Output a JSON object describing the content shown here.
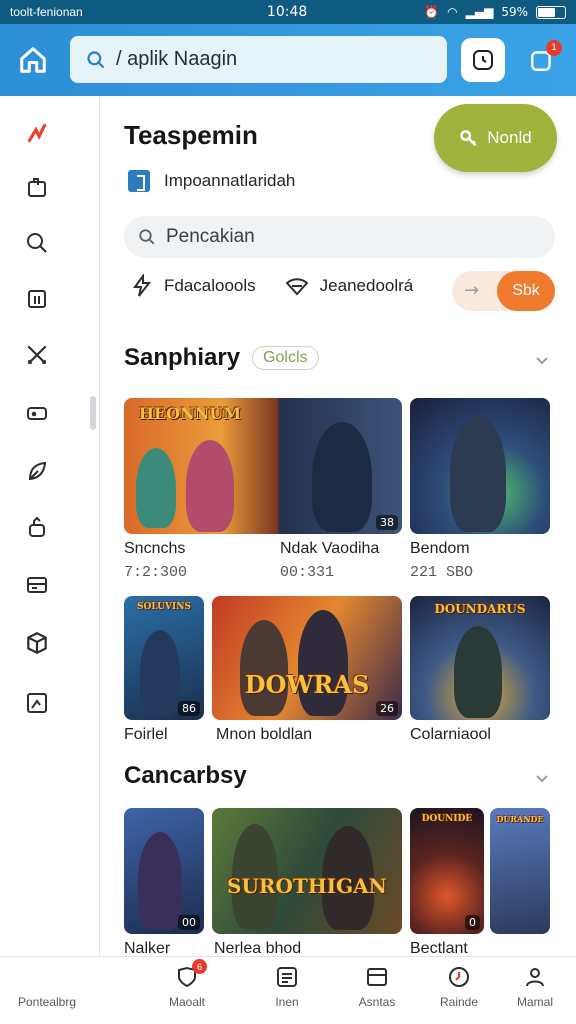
{
  "status_bar": {
    "carrier": "toolt-fenionan",
    "time": "10:48",
    "battery": "59%",
    "battery_level": 0.59
  },
  "header": {
    "search_text": "/ aplik Naagin",
    "notification_count": "1"
  },
  "sidebar": {
    "icons": [
      "flame-icon",
      "bag-icon",
      "search-icon",
      "grid-icon",
      "swords-icon",
      "ticket-icon",
      "leaf-icon",
      "lock-icon",
      "card-icon",
      "cube-icon",
      "chart-icon"
    ]
  },
  "main": {
    "title": "Teaspemin",
    "fab_label": "Nonld",
    "info_text": "Impoannatlaridah",
    "search_placeholder": "Pencakian",
    "chips": [
      "Fdacaloools",
      "Jeanedoolrá"
    ],
    "toggle_label": "Sbk",
    "sections": [
      {
        "title": "Sanphiary",
        "badge": "Golcls",
        "rows": [
          [
            {
              "banner": "HEONNUM",
              "title": "Sncnchs",
              "meta": "7:2:300",
              "badge": ""
            },
            {
              "banner": "",
              "title": "Ndak Vaodiha",
              "meta": "00:331",
              "badge": "38"
            },
            {
              "banner": "",
              "title": "Bendom",
              "meta": "221 SBO",
              "badge": ""
            }
          ],
          [
            {
              "banner": "SOLUVINS",
              "title": "Foirlel",
              "meta": "",
              "badge": "86"
            },
            {
              "banner": "DOWRAS",
              "title": "Mnon boldlan",
              "meta": "",
              "badge": "26"
            },
            {
              "banner": "DOUNDARUS",
              "title": "Colarniaool",
              "meta": "",
              "badge": ""
            }
          ]
        ]
      },
      {
        "title": "Cancarbsy",
        "rows": [
          [
            {
              "banner": "",
              "title": "Nalker",
              "badge": "00"
            },
            {
              "banner": "SUROTHIGAN",
              "title": "Nerlea bhod",
              "badge": ""
            },
            {
              "banner": "DOUNIDE",
              "title": "Bectlant",
              "badge": "0"
            },
            {
              "banner": "DURANDE",
              "title": "",
              "badge": ""
            }
          ]
        ]
      }
    ]
  },
  "bottom_nav": [
    {
      "label": "Pontealbrg",
      "icon": "",
      "badge": ""
    },
    {
      "label": "Maoalt",
      "icon": "shield-icon",
      "badge": "6"
    },
    {
      "label": "Inen",
      "icon": "list-icon",
      "badge": ""
    },
    {
      "label": "Asntas",
      "icon": "window-icon",
      "badge": ""
    },
    {
      "label": "Rainde",
      "icon": "clock-icon",
      "badge": ""
    },
    {
      "label": "Mamal",
      "icon": "user-icon",
      "badge": ""
    }
  ],
  "colors": {
    "header": "#2d8fd6",
    "fab": "#9eb23c",
    "toggle_accent": "#f07b2e",
    "badge_red": "#e43b2c"
  }
}
